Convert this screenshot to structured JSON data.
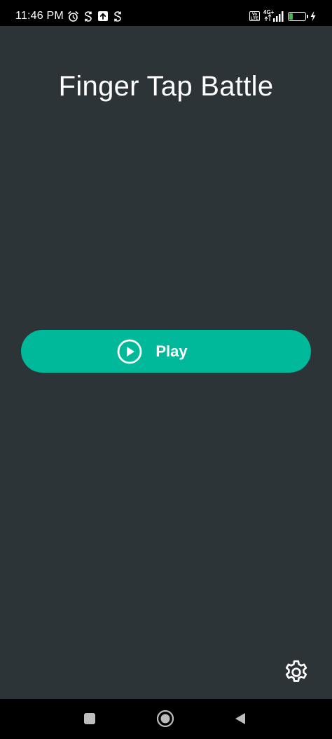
{
  "status_bar": {
    "time": "11:46 PM",
    "volte": "Vo LTE",
    "network": "4G+",
    "battery": "24",
    "battery_level": 0.24,
    "left_icons": [
      "alarm-icon",
      "sync-icon",
      "upload-icon",
      "sync-icon"
    ],
    "right_icons": [
      "volte-icon",
      "signal-icon",
      "battery-icon",
      "charging-icon"
    ]
  },
  "app": {
    "title": "Finger Tap Battle",
    "play_button": {
      "label": "Play",
      "icon": "play-circle-icon"
    },
    "settings_icon": "gear-icon"
  },
  "nav_bar": {
    "buttons": [
      "recents-square-icon",
      "home-circle-icon",
      "back-triangle-icon"
    ]
  },
  "colors": {
    "background": "#2c3438",
    "accent": "#00b89a",
    "text": "#ffffff",
    "system_bars": "#000000",
    "battery_fill": "#3fbf3f"
  }
}
